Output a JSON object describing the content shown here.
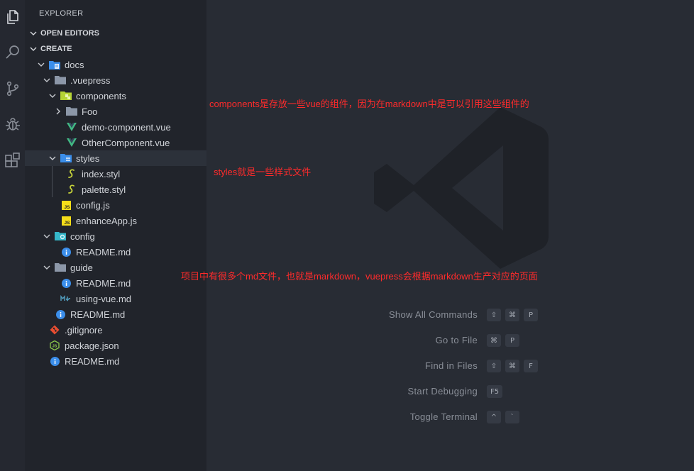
{
  "explorer": {
    "title": "EXPLORER",
    "open_editors": "OPEN EDITORS",
    "project": "CREATE"
  },
  "tree": [
    {
      "name": "docs",
      "icon": "docs-folder-icon"
    },
    {
      "name": ".vuepress",
      "icon": "folder-icon"
    },
    {
      "name": "components",
      "icon": "components-folder-icon"
    },
    {
      "name": "Foo",
      "icon": "folder-icon"
    },
    {
      "name": "demo-component.vue",
      "icon": "vue-icon"
    },
    {
      "name": "OtherComponent.vue",
      "icon": "vue-icon"
    },
    {
      "name": "styles",
      "icon": "styles-folder-icon"
    },
    {
      "name": "index.styl",
      "icon": "stylus-icon"
    },
    {
      "name": "palette.styl",
      "icon": "stylus-icon"
    },
    {
      "name": "config.js",
      "icon": "js-icon"
    },
    {
      "name": "enhanceApp.js",
      "icon": "js-icon"
    },
    {
      "name": "config",
      "icon": "config-folder-icon"
    },
    {
      "name": "README.md",
      "icon": "info-icon"
    },
    {
      "name": "guide",
      "icon": "folder-icon"
    },
    {
      "name": "README.md",
      "icon": "info-icon"
    },
    {
      "name": "using-vue.md",
      "icon": "markdown-icon"
    },
    {
      "name": "README.md",
      "icon": "info-icon"
    },
    {
      "name": ".gitignore",
      "icon": "git-icon"
    },
    {
      "name": "package.json",
      "icon": "nodejs-icon"
    },
    {
      "name": "README.md",
      "icon": "info-icon"
    }
  ],
  "annotations": {
    "components": "components是存放一些vue的组件，因为在markdown中是可以引用这些组件的",
    "styles": "styles就是一些样式文件",
    "md": "项目中有很多个md文件，也就是markdown，vuepress会根据markdown生产对应的页面"
  },
  "commands": [
    {
      "label": "Show All Commands",
      "keys": [
        "⇧",
        "⌘",
        "P"
      ]
    },
    {
      "label": "Go to File",
      "keys": [
        "⌘",
        "P"
      ]
    },
    {
      "label": "Find in Files",
      "keys": [
        "⇧",
        "⌘",
        "F"
      ]
    },
    {
      "label": "Start Debugging",
      "keys": [
        "F5"
      ]
    },
    {
      "label": "Toggle Terminal",
      "keys": [
        "^",
        "`"
      ]
    }
  ],
  "colors": {
    "accent_annotation": "#ff2b2b",
    "sidebar_bg": "#21242b",
    "editor_bg": "#282c34"
  }
}
